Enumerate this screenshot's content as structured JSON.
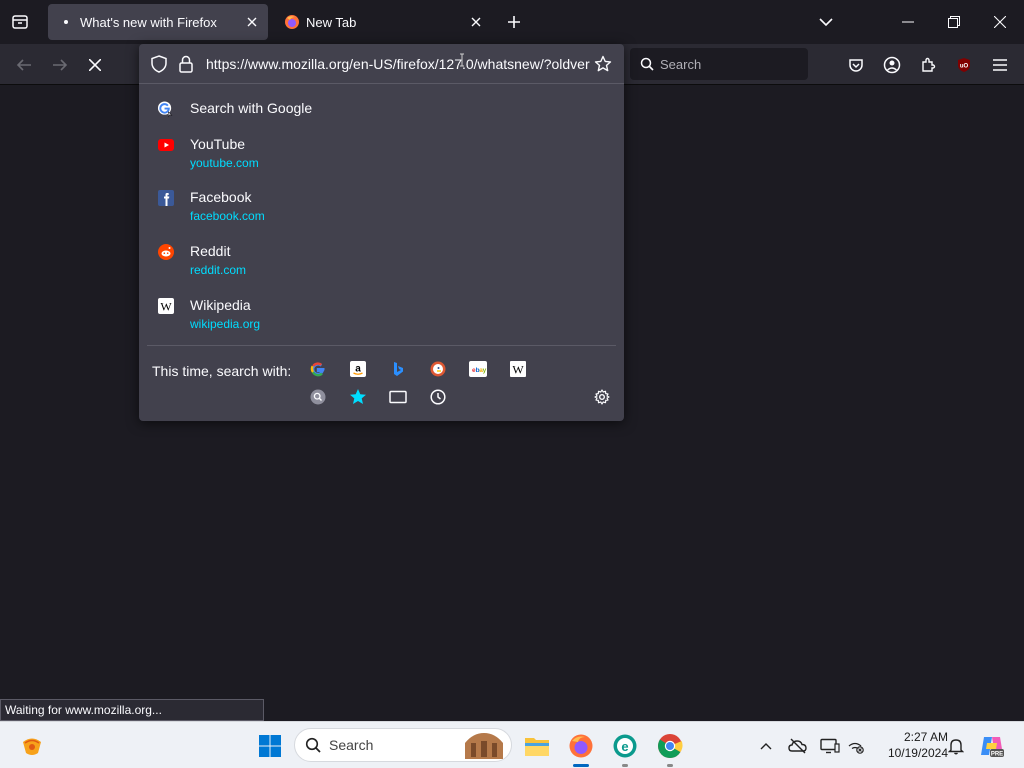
{
  "tabs": [
    {
      "title": "What's new with Firefox",
      "active": true
    },
    {
      "title": "New Tab",
      "active": false
    }
  ],
  "navbar": {
    "search_placeholder": "Search"
  },
  "urlbar": {
    "url": "https://www.mozilla.org/en-US/firefox/127.0/whatsnew/?oldver"
  },
  "results": [
    {
      "title": "Search with Google",
      "url": "",
      "icon": "google-icon"
    },
    {
      "title": "YouTube",
      "url": "youtube.com",
      "icon": "youtube-icon"
    },
    {
      "title": "Facebook",
      "url": "facebook.com",
      "icon": "facebook-icon"
    },
    {
      "title": "Reddit",
      "url": "reddit.com",
      "icon": "reddit-icon"
    },
    {
      "title": "Wikipedia",
      "url": "wikipedia.org",
      "icon": "wikipedia-icon"
    }
  ],
  "oneoff": {
    "label": "This time, search with:",
    "engines": [
      "google",
      "amazon",
      "bing",
      "duckduckgo",
      "ebay",
      "wikipedia"
    ],
    "modes": [
      "tabs",
      "bookmarks",
      "history-box",
      "history"
    ]
  },
  "status": {
    "text": "Waiting for www.mozilla.org..."
  },
  "taskbar": {
    "search_label": "Search",
    "time": "2:27 AM",
    "date": "10/19/2024"
  },
  "colors": {
    "accent": "#00ddff",
    "popup_bg": "#42414d",
    "chrome_bg": "#1c1b22"
  }
}
